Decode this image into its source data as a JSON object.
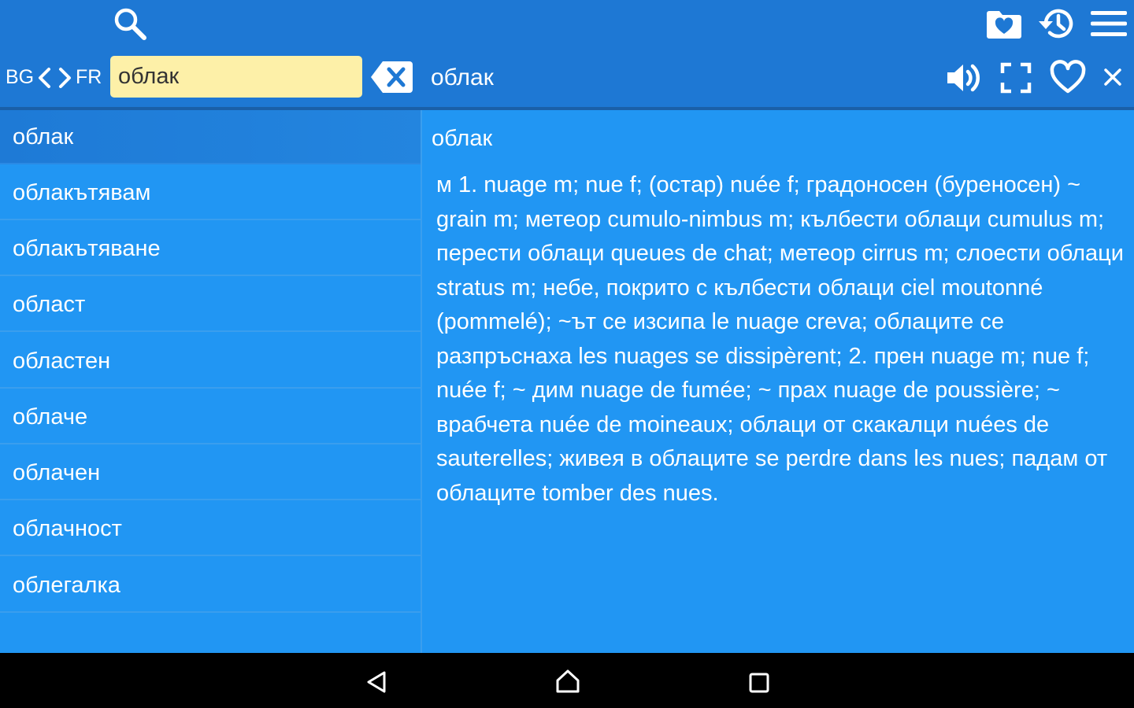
{
  "toolbar": {
    "search_icon": "search-icon",
    "favorites_folder_icon": "folder-heart-icon",
    "history_icon": "history-icon",
    "menu_icon": "menu-icon"
  },
  "language": {
    "source": "BG",
    "target": "FR"
  },
  "search": {
    "value": "облак"
  },
  "header": {
    "current_word": "облак"
  },
  "word_list": [
    {
      "label": "облак",
      "selected": true
    },
    {
      "label": "облакътявам"
    },
    {
      "label": "облакътяване"
    },
    {
      "label": "област"
    },
    {
      "label": "областен"
    },
    {
      "label": "облаче"
    },
    {
      "label": "облачен"
    },
    {
      "label": "облачност"
    },
    {
      "label": "облегалка"
    }
  ],
  "entry": {
    "headword": "облак",
    "definition": "м 1. nuage m; nue f; (остар) nuée f; градоносен (буреносен) ~ grain m; метеор cumulo-nimbus m; кълбести облаци cumulus m; перести облаци queues de chat; метеор cirrus m; слоести облаци stratus m; небе, покрито с кълбести облаци ciel moutonné (pommelé); ~ът се изсипа le nuage creva; облаците се разпръснаха les nuages se dissipèrent; 2. прен nuage m; nue f; nuée f; ~ дим nuage de fumée; ~ прах nuage de poussière; ~ врабчета nuée de moineaux; облаци от скакалци nuées de sauterelles; живея в облаците se perdre dans les nues; падам от облаците tomber des nues."
  },
  "colors": {
    "background": "#2196F3",
    "topbar": "#1E78D4",
    "search_field": "#FDF0A8",
    "selected_item": "#1E7AD6"
  }
}
